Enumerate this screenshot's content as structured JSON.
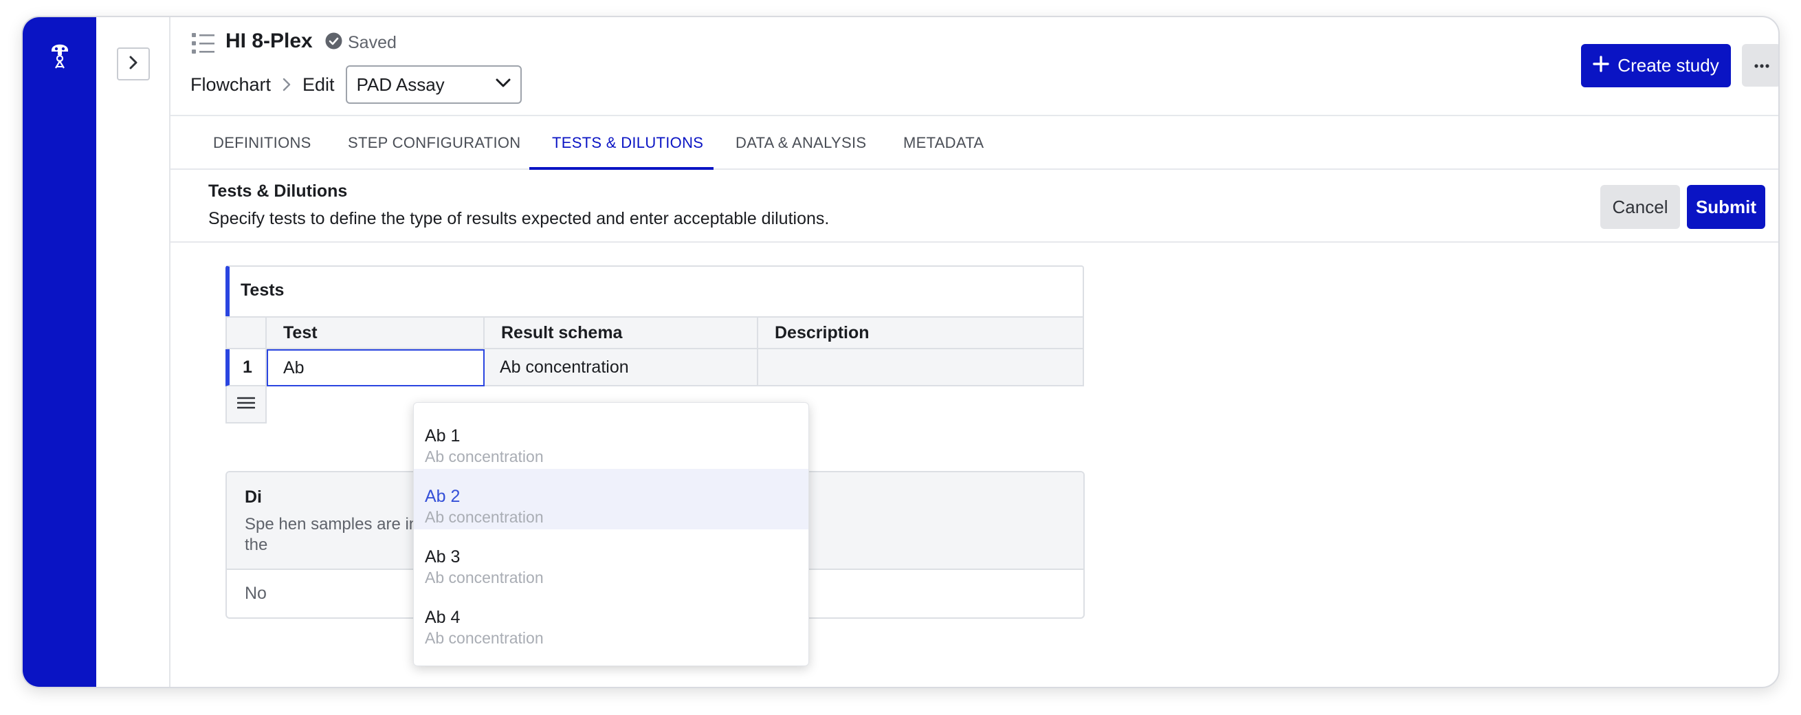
{
  "header": {
    "title": "HI 8-Plex",
    "saved_label": "Saved",
    "breadcrumb": [
      "Flowchart",
      "Edit"
    ],
    "assay_select": "PAD Assay",
    "create_label": "Create study",
    "more_label": "···"
  },
  "tabs": [
    "DEFINITIONS",
    "STEP CONFIGURATION",
    "TESTS & DILUTIONS",
    "DATA & ANALYSIS",
    "METADATA"
  ],
  "active_tab": "TESTS & DILUTIONS",
  "section": {
    "title": "Tests & Dilutions",
    "description": "Specify tests to define the type of results expected and enter acceptable dilutions.",
    "cancel_label": "Cancel",
    "submit_label": "Submit"
  },
  "tests_card": {
    "title": "Tests",
    "columns": [
      "Test",
      "Result schema",
      "Description"
    ],
    "rows": [
      {
        "num": "1",
        "test": "Ab",
        "schema": "Ab concentration",
        "description": ""
      }
    ]
  },
  "dilutions_card": {
    "title": "Di",
    "desc_line1": "Spe                                                          hen samples are ingested, tests will be ordered using",
    "desc_line2": "the",
    "empty": "No"
  },
  "dropdown": {
    "options": [
      {
        "name": "Ab 1",
        "sub": "Ab concentration"
      },
      {
        "name": "Ab 2",
        "sub": "Ab concentration"
      },
      {
        "name": "Ab 3",
        "sub": "Ab concentration"
      },
      {
        "name": "Ab 4",
        "sub": "Ab concentration"
      }
    ],
    "highlighted_index": 1
  },
  "colors": {
    "brand": "#0a14c4",
    "accent_blue": "#2a45e0",
    "button_grey": "#e3e4e7"
  },
  "icons": [
    "app-logo-icon",
    "chevron-right-icon",
    "list-icon",
    "check-circle-icon",
    "chevron-down-icon",
    "plus-icon",
    "more-icon",
    "menu-icon"
  ]
}
